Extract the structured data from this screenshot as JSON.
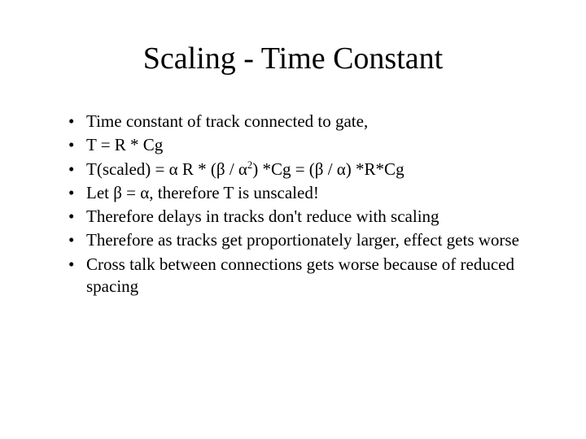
{
  "title": "Scaling - Time Constant",
  "bullets": [
    "Time constant of track connected to gate,",
    "T = R * Cg",
    "T(scaled) = α R * (β / α",
    ") *Cg = (β / α) *R*Cg",
    "Let β = α, therefore T is unscaled!",
    "Therefore delays in tracks don't reduce with scaling",
    "Therefore as tracks get proportionately larger, effect gets worse",
    "Cross talk between connections gets worse because of reduced spacing"
  ],
  "sup": "2"
}
